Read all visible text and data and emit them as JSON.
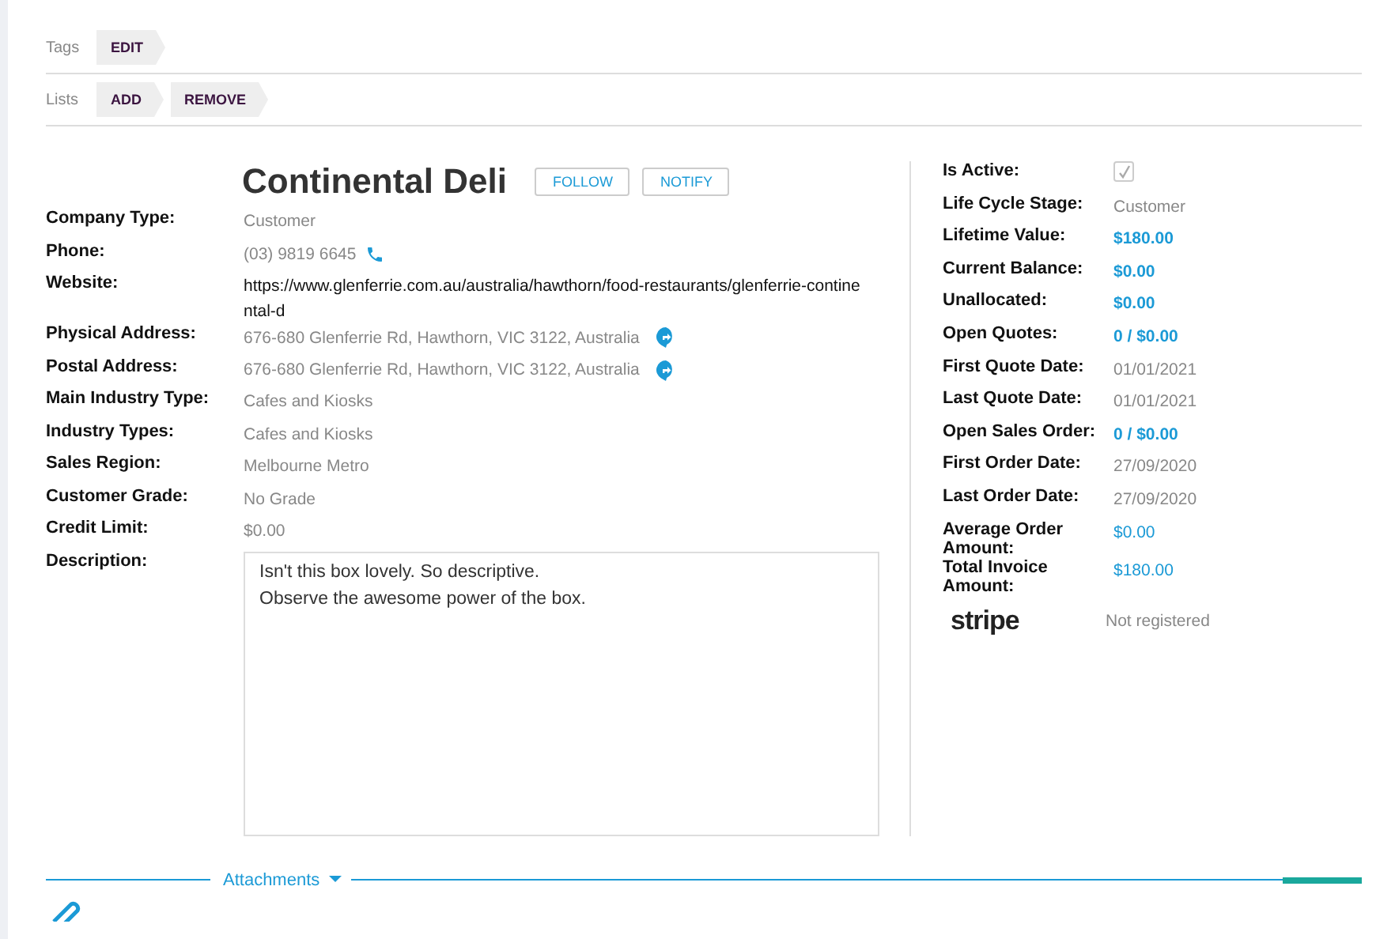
{
  "toolbar": [
    {
      "label": "Tags",
      "buttons": [
        "EDIT"
      ]
    },
    {
      "label": "Lists",
      "buttons": [
        "ADD",
        "REMOVE"
      ]
    }
  ],
  "title": "Continental Deli",
  "header_buttons": [
    "FOLLOW",
    "NOTIFY"
  ],
  "fields": [
    {
      "label": "Company Type:",
      "value": "Customer",
      "kind": "text"
    },
    {
      "label": "Phone:",
      "value": "(03) 9819 6645",
      "kind": "phone"
    },
    {
      "label": "Website:",
      "value": "https://www.glenferrie.com.au/australia/hawthorn/food-restaurants/glenferrie-continental-d",
      "kind": "website"
    },
    {
      "label": "Physical Address:",
      "value": "676-680 Glenferrie Rd, Hawthorn, VIC 3122, Australia",
      "kind": "address"
    },
    {
      "label": "Postal Address:",
      "value": "676-680 Glenferrie Rd, Hawthorn, VIC 3122, Australia",
      "kind": "address"
    },
    {
      "label": "Main Industry Type:",
      "value": "Cafes and Kiosks",
      "kind": "text"
    },
    {
      "label": "Industry Types:",
      "value": "Cafes and Kiosks",
      "kind": "text"
    },
    {
      "label": "Sales Region:",
      "value": "Melbourne Metro",
      "kind": "text"
    },
    {
      "label": "Customer Grade:",
      "value": "No Grade",
      "kind": "text"
    },
    {
      "label": "Credit Limit:",
      "value": "$0.00",
      "kind": "text"
    },
    {
      "label": "Description:",
      "lines": [
        "Isn't this box lovely. So descriptive.",
        "Observe the awesome power of the box."
      ],
      "kind": "description"
    }
  ],
  "summary": [
    {
      "label": "Is Active:",
      "kind": "checkbox",
      "checked": true
    },
    {
      "label": "Life Cycle Stage:",
      "value": "Customer",
      "kind": "text"
    },
    {
      "label": "Lifetime Value:",
      "value": "$180.00",
      "kind": "link"
    },
    {
      "label": "Current Balance:",
      "value": "$0.00",
      "kind": "link"
    },
    {
      "label": "Unallocated:",
      "value": "$0.00",
      "kind": "link"
    },
    {
      "label": "Open Quotes:",
      "value": "0 / $0.00",
      "kind": "link"
    },
    {
      "label": "First Quote Date:",
      "value": "01/01/2021",
      "kind": "text"
    },
    {
      "label": "Last Quote Date:",
      "value": "01/01/2021",
      "kind": "text"
    },
    {
      "label": "Open Sales Order:",
      "value": "0 / $0.00",
      "kind": "link"
    },
    {
      "label": "First Order Date:",
      "value": "27/09/2020",
      "kind": "text"
    },
    {
      "label": "Last Order Date:",
      "value": "27/09/2020",
      "kind": "text"
    },
    {
      "label": "Average Order Amount:",
      "value": "$0.00",
      "kind": "amount"
    },
    {
      "label": "Total Invoice Amount:",
      "value": "$180.00",
      "kind": "amount"
    }
  ],
  "stripe": {
    "logo": "stripe",
    "status": "Not registered"
  },
  "attachments": {
    "label": "Attachments"
  }
}
